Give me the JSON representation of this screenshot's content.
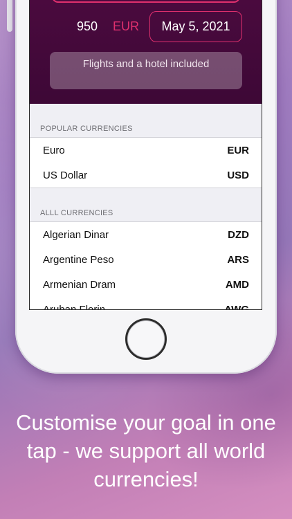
{
  "header": {
    "amount": "950",
    "currency": "EUR",
    "date": "May 5, 2021",
    "description": "Flights and a hotel included"
  },
  "sections": {
    "popular_title": "POPULAR CURRENCIES",
    "all_title": "ALLL CURRENCIES"
  },
  "popular": [
    {
      "name": "Euro",
      "code": "EUR"
    },
    {
      "name": "US Dollar",
      "code": "USD"
    }
  ],
  "all": [
    {
      "name": "Algerian Dinar",
      "code": "DZD"
    },
    {
      "name": "Argentine Peso",
      "code": "ARS"
    },
    {
      "name": "Armenian Dram",
      "code": "AMD"
    },
    {
      "name": "Aruban Florin",
      "code": "AWG"
    }
  ],
  "caption": "Customise your goal in one tap - we support all world currencies!",
  "colors": {
    "accent": "#e0306e",
    "header_bg": "#4a0a3e"
  }
}
